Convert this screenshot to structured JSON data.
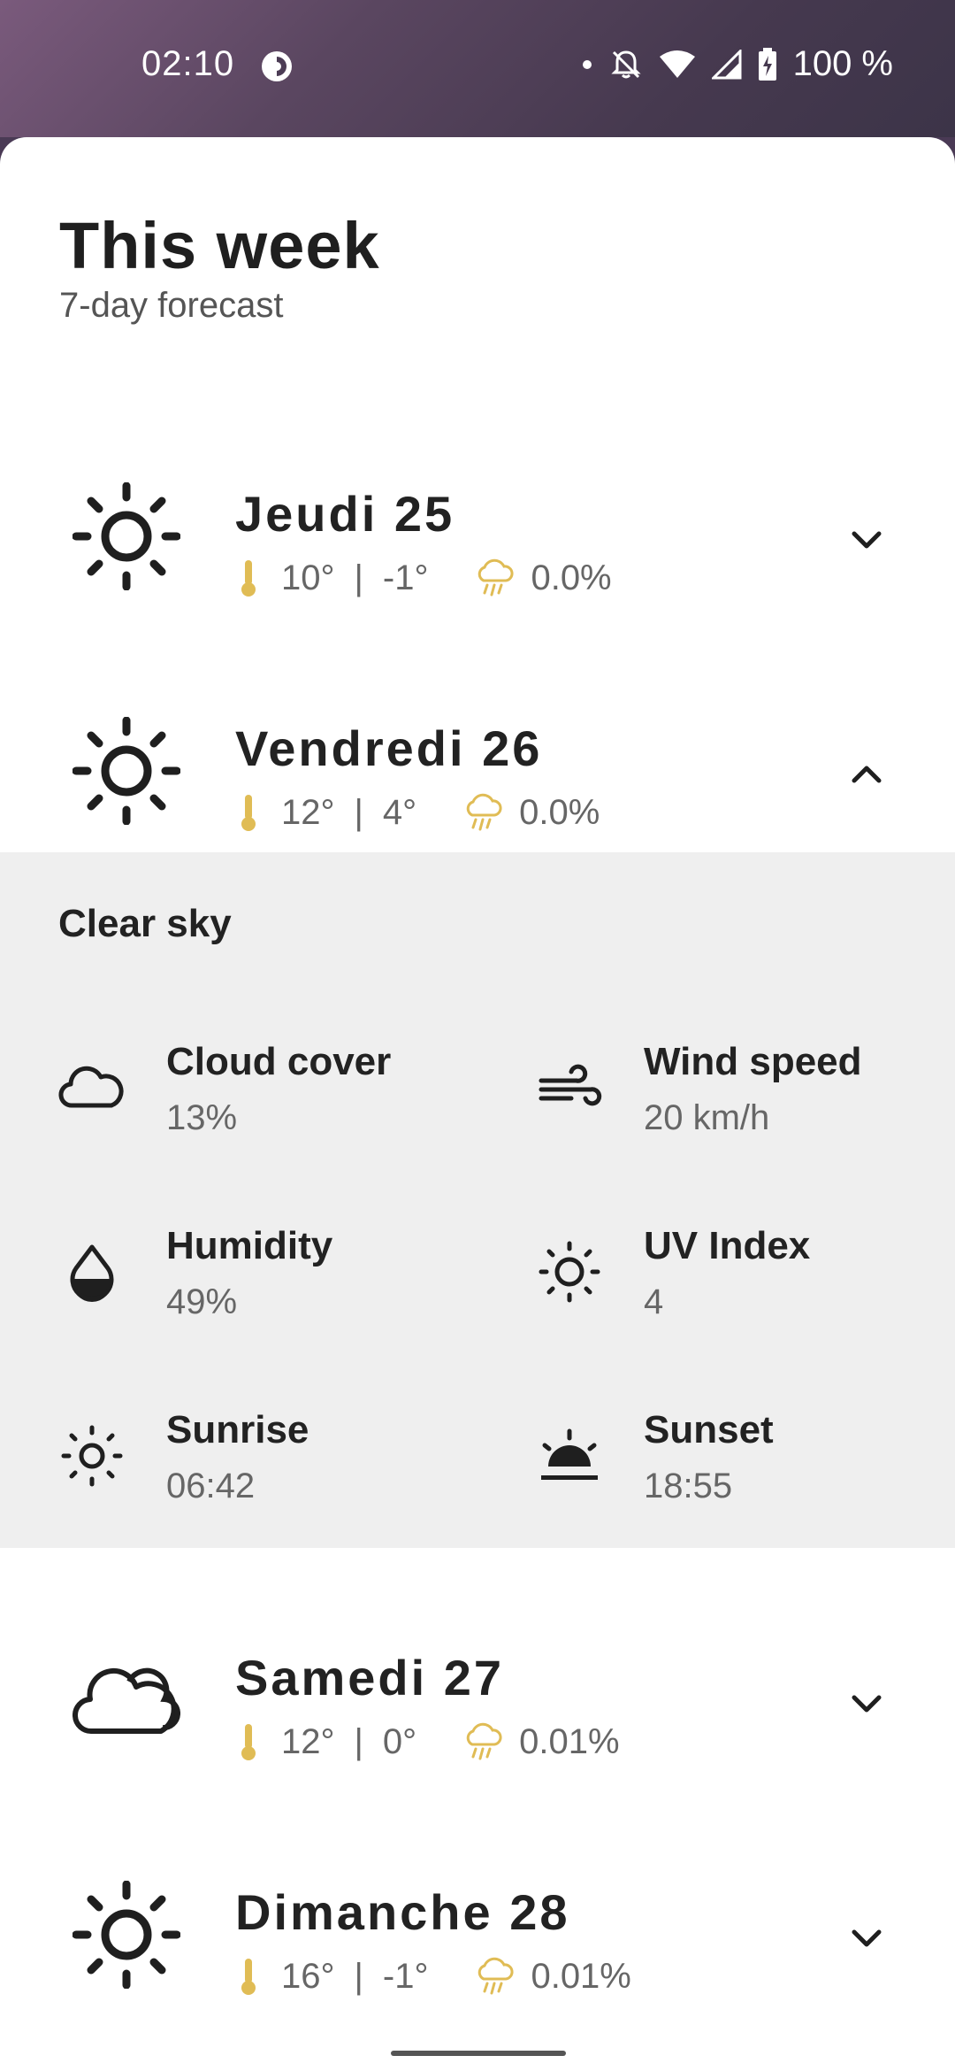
{
  "status_bar": {
    "time": "02:10",
    "battery": "100 %"
  },
  "header": {
    "title": "This week",
    "subtitle": "7-day forecast"
  },
  "days": [
    {
      "name": "Jeudi 25",
      "max": "10°",
      "sep": "|",
      "min": "-1°",
      "precip": "0.0%",
      "icon": "sun-icon",
      "expanded": false
    },
    {
      "name": "Vendredi 26",
      "max": "12°",
      "sep": "|",
      "min": "4°",
      "precip": "0.0%",
      "icon": "sun-icon",
      "expanded": true
    },
    {
      "name": "Samedi 27",
      "max": "12°",
      "sep": "|",
      "min": "0°",
      "precip": "0.01%",
      "icon": "cloud-icon",
      "expanded": false
    },
    {
      "name": "Dimanche 28",
      "max": "16°",
      "sep": "|",
      "min": "-1°",
      "precip": "0.01%",
      "icon": "sun-icon",
      "expanded": false
    }
  ],
  "details": {
    "condition": "Clear sky",
    "cloud_cover": {
      "label": "Cloud cover",
      "value": "13%"
    },
    "wind_speed": {
      "label": "Wind speed",
      "value": "20 km/h"
    },
    "humidity": {
      "label": "Humidity",
      "value": "49%"
    },
    "uv_index": {
      "label": "UV Index",
      "value": "4"
    },
    "sunrise": {
      "label": "Sunrise",
      "value": "06:42"
    },
    "sunset": {
      "label": "Sunset",
      "value": "18:55"
    }
  },
  "colors": {
    "accent": "#e0bc55",
    "panel": "#efefef"
  }
}
